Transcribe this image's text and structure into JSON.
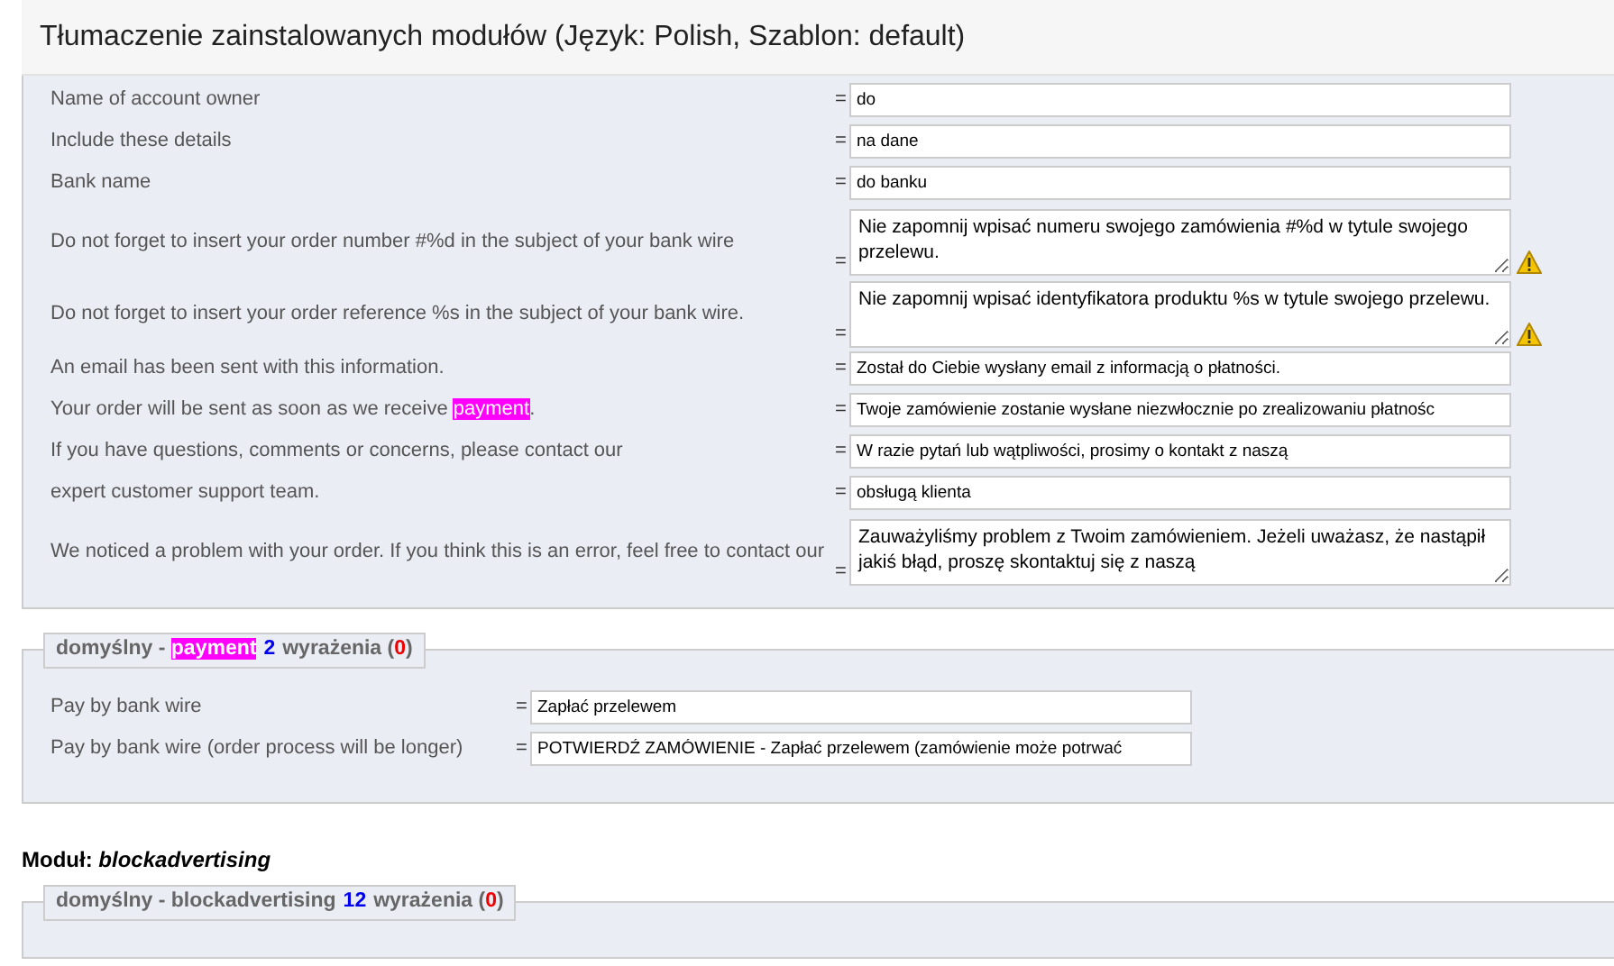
{
  "header": {
    "title": "Tłumaczenie zainstalowanych modułów (Język: Polish, Szablon: default)"
  },
  "groups": [
    {
      "rows": [
        {
          "label": [
            {
              "text": "Name of account owner",
              "highlighted": false
            }
          ],
          "eq": "=",
          "kind": "input",
          "value": "do",
          "warning": false
        },
        {
          "label": [
            {
              "text": "Include these details",
              "highlighted": false
            }
          ],
          "eq": "=",
          "kind": "input",
          "value": "na dane",
          "warning": false
        },
        {
          "label": [
            {
              "text": "Bank name",
              "highlighted": false
            }
          ],
          "eq": "=",
          "kind": "input",
          "value": "do banku",
          "warning": false
        },
        {
          "label": [
            {
              "text": "Do not forget to insert your order number #%d in the subject of your bank wire",
              "highlighted": false
            }
          ],
          "eq": "=",
          "kind": "textarea",
          "value": "Nie zapomnij wpisać numeru swojego zamówienia #%d w tytule swojego przelewu.",
          "warning": true
        },
        {
          "label": [
            {
              "text": "Do not forget to insert your order reference %s in the subject of your bank wire.",
              "highlighted": false
            }
          ],
          "eq": "=",
          "kind": "textarea",
          "value": "Nie zapomnij wpisać identyfikatora produktu %s w tytule swojego przelewu.",
          "warning": true
        },
        {
          "label": [
            {
              "text": "An email has been sent with this information.",
              "highlighted": false
            }
          ],
          "eq": "=",
          "kind": "input",
          "value": "Został do Ciebie wysłany email z informacją o płatności.",
          "warning": false
        },
        {
          "label": [
            {
              "text": "Your order will be sent as soon as we receive ",
              "highlighted": false
            },
            {
              "text": "payment",
              "highlighted": true
            },
            {
              "text": ".",
              "highlighted": false
            }
          ],
          "eq": "=",
          "kind": "input",
          "value": "Twoje zamówienie zostanie wysłane niezwłocznie po zrealizowaniu płatnośc",
          "warning": false
        },
        {
          "label": [
            {
              "text": "If you have questions, comments or concerns, please contact our",
              "highlighted": false
            }
          ],
          "eq": "=",
          "kind": "input",
          "value": "W razie pytań lub wątpliwości, prosimy o kontakt z naszą",
          "warning": false
        },
        {
          "label": [
            {
              "text": "expert customer support team.",
              "highlighted": false
            }
          ],
          "eq": "=",
          "kind": "input",
          "value": "obsługą klienta",
          "warning": false
        },
        {
          "label": [
            {
              "text": "We noticed a problem with your order. If you think this is an error, feel free to contact our",
              "highlighted": false
            }
          ],
          "eq": "=",
          "kind": "textarea",
          "value": "Zauważyliśmy problem z Twoim zamówieniem. Jeżeli uważasz, że nastąpił jakiś błąd, proszę skontaktuj się z naszą",
          "warning": false
        }
      ]
    },
    {
      "legend": {
        "prefix": "domyślny - ",
        "name": "payment",
        "highlighted": true,
        "count": "2",
        "word": "wyrażenia (",
        "missing": "0",
        "close": ")"
      },
      "rows": [
        {
          "label": [
            {
              "text": "Pay by bank wire",
              "highlighted": false
            }
          ],
          "eq": "=",
          "kind": "input",
          "value": "Zapłać przelewem",
          "warning": false
        },
        {
          "label": [
            {
              "text": "Pay by bank wire (order process will be longer)",
              "highlighted": false
            }
          ],
          "eq": "=",
          "kind": "input",
          "value": "POTWIERDŹ ZAMÓWIENIE - Zapłać przelewem (zamówienie może potrwać",
          "warning": false
        }
      ]
    }
  ],
  "module": {
    "label": "Moduł:",
    "name": "blockadvertising"
  },
  "module_group": {
    "legend": {
      "prefix": "domyślny - ",
      "name": "blockadvertising",
      "highlighted": false,
      "count": "12",
      "word": "wyrażenia (",
      "missing": "0",
      "close": ")"
    }
  }
}
